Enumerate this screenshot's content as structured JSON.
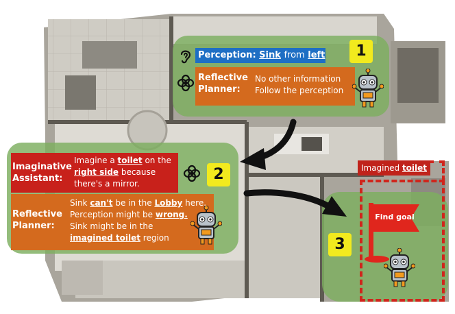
{
  "steps": {
    "one": {
      "badge": "1",
      "perception": {
        "label": "Perception:",
        "object": "Sink",
        "word_from": "from",
        "direction": "left"
      },
      "planner": {
        "label_line1": "Reflective",
        "label_line2": "Planner:",
        "line1": "No other information",
        "line2": "Follow the perception"
      }
    },
    "two": {
      "badge": "2",
      "assistant": {
        "label_line1": "Imaginative",
        "label_line2": "Assistant:",
        "l1_pre": "Imagine a",
        "l1_obj": "toilet",
        "l1_post": "on the",
        "l2_obj": "right side",
        "l2_post": "because",
        "l3": "there's a mirror."
      },
      "planner": {
        "label_line1": "Reflective",
        "label_line2": "Planner:",
        "l1_pre": "Sink",
        "l1_neg": "can't",
        "l1_mid": "be in the",
        "l1_obj": "Lobby",
        "l1_post": "here.",
        "l2_pre": "Perception might be",
        "l2_neg": "wrong.",
        "l3": "Sink might be in the",
        "l4_obj": "imagined toilet",
        "l4_post": "region"
      }
    },
    "three": {
      "badge": "3",
      "imagined_pre": "Imagined",
      "imagined_obj": "toilet",
      "flag_label": "Find goal"
    }
  },
  "colors": {
    "panel_green": "#7daf5f",
    "perception_blue": "#1e6fc4",
    "planner_orange": "#d46a1e",
    "assistant_red": "#c8211b",
    "badge_yellow": "#f2ea1e",
    "dash_red": "#d0251c"
  },
  "icons": [
    "ear-icon",
    "openai-icon",
    "robot-icon",
    "flag-icon",
    "arrow-icon"
  ]
}
